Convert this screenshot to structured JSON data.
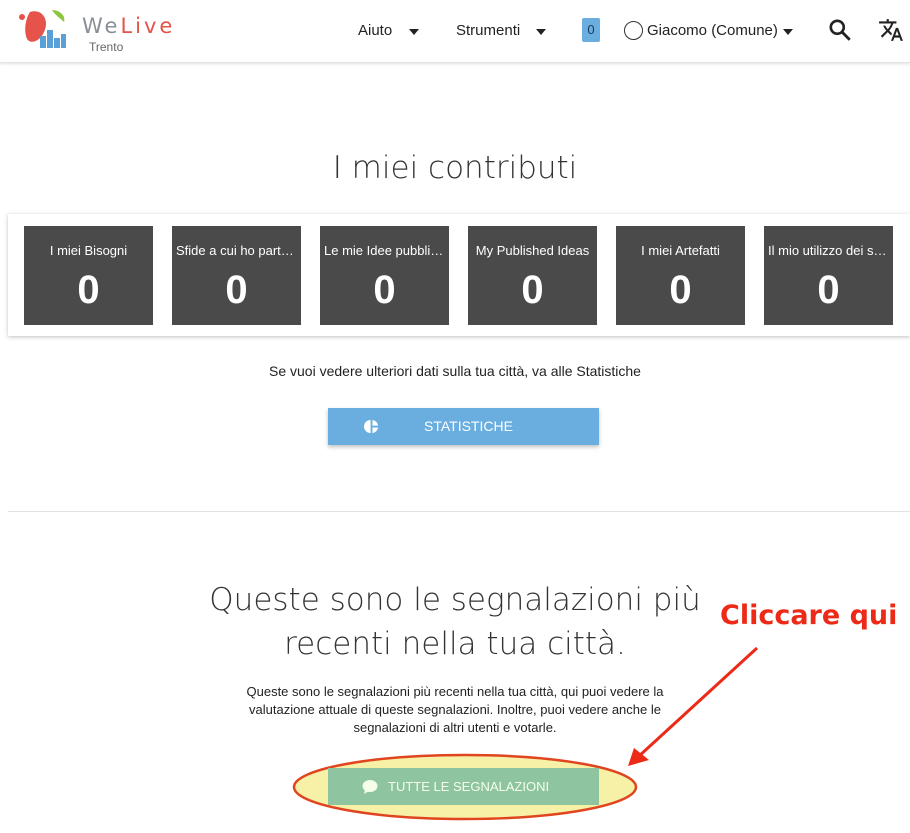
{
  "header": {
    "brand_we": "We",
    "brand_live": "Live",
    "brand_sub": "Trento",
    "menu_help": "Aiuto",
    "menu_tools": "Strumenti",
    "notification_count": "0",
    "user_name": "Giacomo (Comune)",
    "icons": [
      "welive-logo",
      "caret-down-icon",
      "user-circle-icon",
      "search-icon",
      "translate-icon"
    ]
  },
  "contributions": {
    "title": "I miei contributi",
    "tiles": [
      {
        "label": "I miei Bisogni",
        "value": "0"
      },
      {
        "label": "Sfide a cui ho partecipato",
        "value": "0"
      },
      {
        "label": "Le mie Idee pubblicate",
        "value": "0"
      },
      {
        "label": "My Published Ideas",
        "value": "0"
      },
      {
        "label": "I miei Artefatti",
        "value": "0"
      },
      {
        "label": "Il mio utilizzo dei servizi",
        "value": "0"
      }
    ],
    "hint": "Se vuoi vedere ulteriori dati sulla tua città, va alle Statistiche",
    "stats_button": "STATISTICHE"
  },
  "reports": {
    "title_line1": "Queste sono le segnalazioni più",
    "title_line2": "recenti nella tua città.",
    "description": "Queste sono le segnalazioni più recenti nella tua città, qui puoi vedere la valutazione attuale di queste segnalazioni. Inoltre, puoi vedere anche le segnalazioni di altri utenti e votarle.",
    "all_button": "TUTTE LE SEGNALAZIONI"
  },
  "annotation": {
    "text": "Cliccare qui",
    "color": "#ec2a17",
    "highlight": "#f6f1a6"
  },
  "colors": {
    "tile_bg": "#4a4a4a",
    "stats_button": "#6aaee0",
    "reports_button": "#8fc4a0"
  }
}
